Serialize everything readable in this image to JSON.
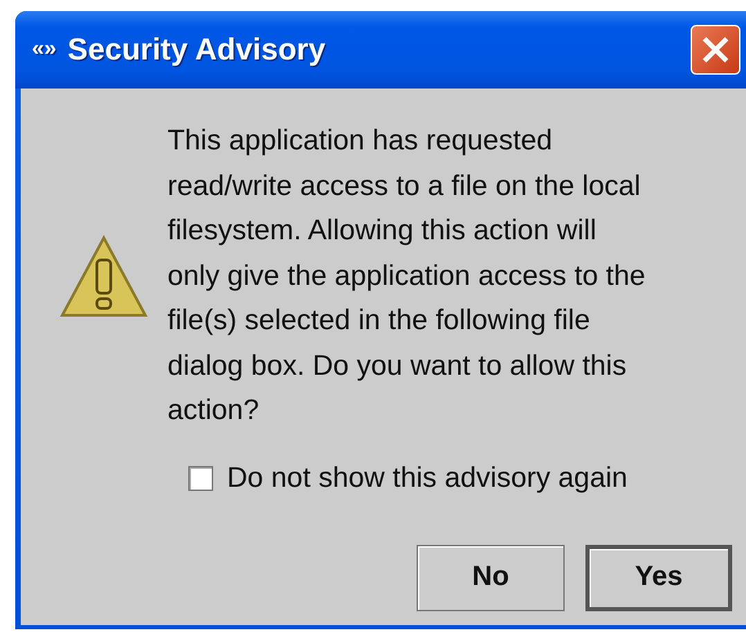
{
  "window": {
    "icon_text": "«»",
    "title": "Security Advisory"
  },
  "message": "This application has requested\nread/write access to a file on the local\nfilesystem.  Allowing this action will\nonly give the application access to the\nfile(s) selected in the following file\ndialog box.  Do you want to allow this\naction?",
  "checkbox": {
    "label": "Do not show this advisory again",
    "checked": false
  },
  "buttons": [
    {
      "label": "No",
      "default": false
    },
    {
      "label": "Yes",
      "default": true
    }
  ]
}
